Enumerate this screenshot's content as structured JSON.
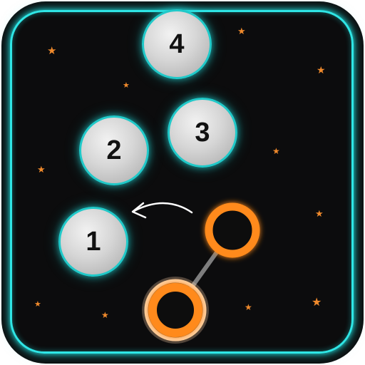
{
  "balls": [
    {
      "label": "4"
    },
    {
      "label": "3"
    },
    {
      "label": "2"
    },
    {
      "label": "1"
    }
  ],
  "colors": {
    "frame_neon": "#2fe6e6",
    "ball_ring": "#20c9c9",
    "player_ring": "#ff8a1a",
    "star": "#f08a2c",
    "background": "#0c0c0d"
  },
  "icons": {
    "direction_hint": "curved-arrow-left-icon",
    "background_decor": "star-icon"
  }
}
